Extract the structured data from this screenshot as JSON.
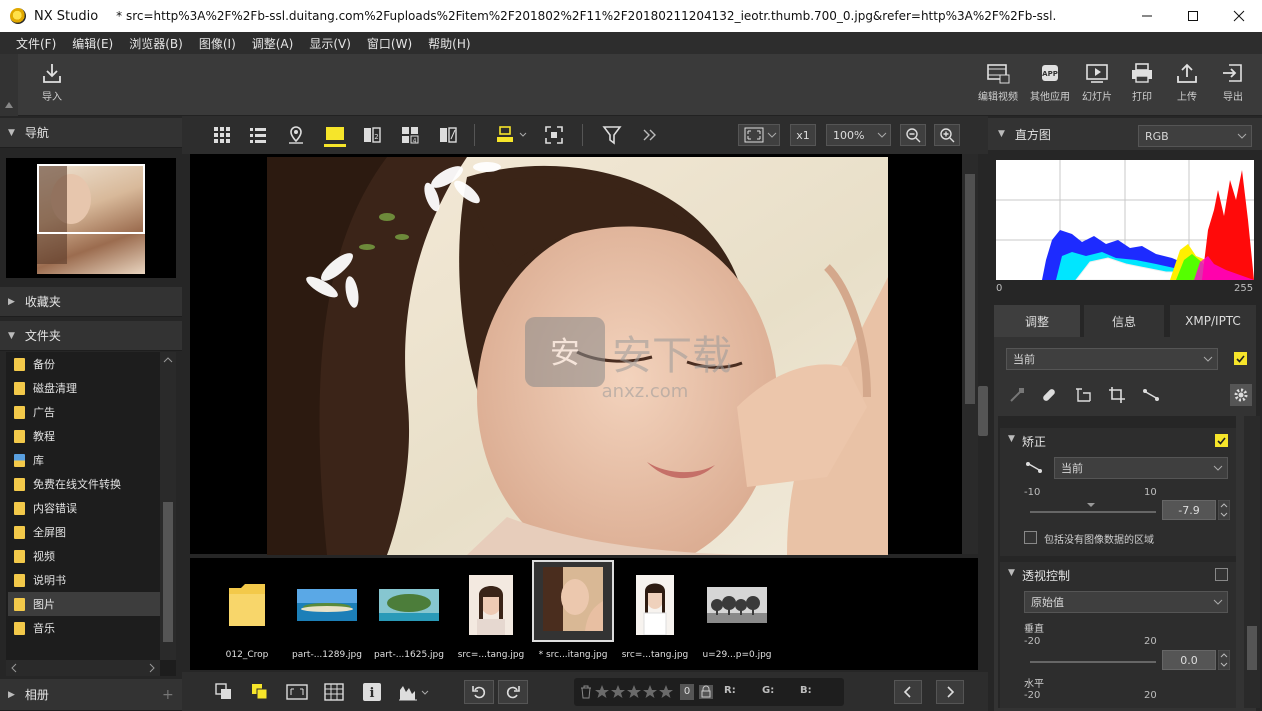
{
  "window": {
    "app_name": "NX Studio",
    "doc_title": "* src=http%3A%2F%2Fb-ssl.duitang.com%2Fuploads%2Fitem%2F201802%2F11%2F20180211204132_ieotr.thumb.700_0.jpg&refer=http%3A%2F%2Fb-ssl.duitang.com"
  },
  "menu": [
    "文件(F)",
    "编辑(E)",
    "浏览器(B)",
    "图像(I)",
    "调整(A)",
    "显示(V)",
    "窗口(W)",
    "帮助(H)"
  ],
  "toolbar": {
    "import_label": "导入",
    "right_buttons": [
      {
        "label": "编辑视频",
        "icon": "film-edit-icon"
      },
      {
        "label": "其他应用",
        "icon": "app-icon"
      },
      {
        "label": "幻灯片",
        "icon": "slideshow-icon"
      },
      {
        "label": "打印",
        "icon": "printer-icon"
      },
      {
        "label": "上传",
        "icon": "upload-icon"
      },
      {
        "label": "导出",
        "icon": "export-icon"
      }
    ]
  },
  "left": {
    "nav_title": "导航",
    "favorites_title": "收藏夹",
    "folders_title": "文件夹",
    "albums_title": "相册",
    "folders": [
      {
        "name": "备份"
      },
      {
        "name": "磁盘清理"
      },
      {
        "name": "广告"
      },
      {
        "name": "教程"
      },
      {
        "name": "库"
      },
      {
        "name": "免费在线文件转换"
      },
      {
        "name": "内容错误"
      },
      {
        "name": "全屏图"
      },
      {
        "name": "视频"
      },
      {
        "name": "说明书"
      },
      {
        "name": "图片",
        "selected": true
      },
      {
        "name": "音乐"
      }
    ]
  },
  "viewer": {
    "zoom_x1": "x1",
    "zoom_level": "100%"
  },
  "watermark": {
    "brand": "安下载",
    "domain": "anxz.com"
  },
  "filmstrip": [
    {
      "caption": "012_Crop",
      "kind": "folder"
    },
    {
      "caption": "part-...1289.jpg",
      "kind": "island"
    },
    {
      "caption": "part-...1625.jpg",
      "kind": "island2"
    },
    {
      "caption": "src=...tang.jpg",
      "kind": "portrait"
    },
    {
      "caption": "* src...itang.jpg",
      "kind": "portrait-selected",
      "selected": true
    },
    {
      "caption": "src=...tang.jpg",
      "kind": "portrait2"
    },
    {
      "caption": "u=29...p=0.jpg",
      "kind": "trees"
    }
  ],
  "statusbar": {
    "r_label": "R:",
    "g_label": "G:",
    "b_label": "B:",
    "rating_count": "0"
  },
  "right": {
    "histogram_title": "直方图",
    "channel": "RGB",
    "hist_min": "0",
    "hist_max": "255",
    "tabs": [
      "调整",
      "信息",
      "XMP/IPTC"
    ],
    "preset": "当前",
    "straighten": {
      "title": "矫正",
      "preset": "当前",
      "min": "-10",
      "max": "10",
      "value": "-7.9",
      "include_label": "包括没有图像数据的区域"
    },
    "perspective": {
      "title": "透视控制",
      "preset": "原始值",
      "vertical_label": "垂直",
      "v_min": "-20",
      "v_max": "20",
      "v_value": "0.0",
      "horizontal_label": "水平",
      "h_min": "-20",
      "h_max": "20"
    }
  },
  "colors": {
    "accent": "#f6e52a",
    "folder": "#f3c94a"
  }
}
